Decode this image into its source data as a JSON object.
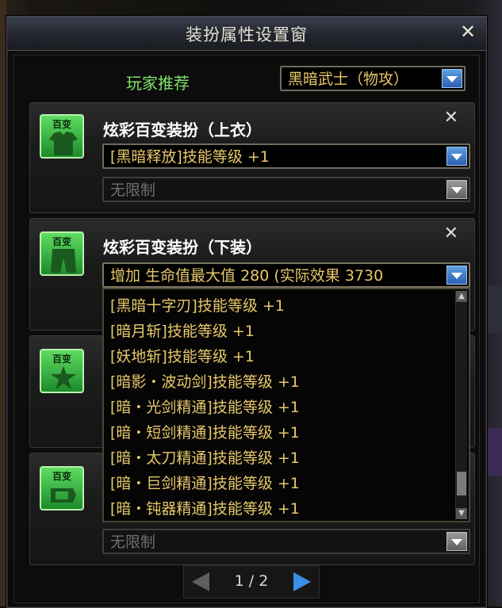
{
  "window": {
    "title": "装扮属性设置窗",
    "close_label": "✕"
  },
  "recommend": {
    "label": "玩家推荐",
    "selected": "黑暗武士（物攻）"
  },
  "sections": [
    {
      "title": "炫彩百变装扮（上衣）",
      "icon_label": "百变",
      "primary_value": "[黑暗释放]技能等级 +1",
      "secondary_value": "无限制"
    },
    {
      "title": "炫彩百变装扮（下装）",
      "icon_label": "百变",
      "primary_value": "增加 生命值最大值 280 (实际效果 3730"
    },
    {
      "icon_label": "百变"
    },
    {
      "icon_label": "百变",
      "secondary_value": "无限制"
    }
  ],
  "options": [
    "[黑暗十字刃]技能等级 +1",
    "[暗月斩]技能等级 +1",
    "[妖地斩]技能等级 +1",
    "[暗影・波动剑]技能等级 +1",
    "[暗・光剑精通]技能等级 +1",
    "[暗・短剑精通]技能等级 +1",
    "[暗・太刀精通]技能等级 +1",
    "[暗・巨剑精通]技能等级 +1",
    "[暗・钝器精通]技能等级 +1"
  ],
  "pager": {
    "text": "1 / 2"
  },
  "colors": {
    "accent_green": "#7ee36a",
    "gold_text": "#e7c86a",
    "button_blue": "#3c8fe8"
  }
}
